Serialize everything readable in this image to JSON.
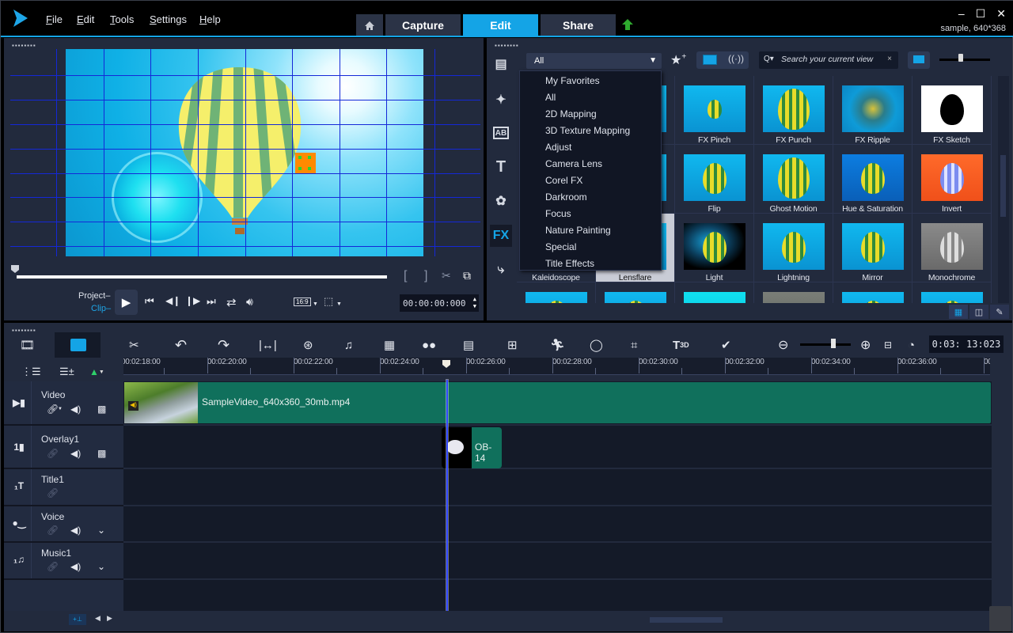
{
  "app": {
    "project_info": "sample, 640*368",
    "menu": [
      "File",
      "Edit",
      "Tools",
      "Settings",
      "Help"
    ],
    "tabs": [
      {
        "label": "Capture",
        "active": false
      },
      {
        "label": "Edit",
        "active": true
      },
      {
        "label": "Share",
        "active": false
      }
    ],
    "home_icon": "home-icon",
    "upload_icon": "upload-arrow-icon",
    "window_controls": {
      "minimize": "–",
      "maximize": "☐",
      "close": "✕"
    },
    "accent_color": "#14a4e6"
  },
  "player": {
    "mode_labels": {
      "project": "Project–",
      "clip": "Clip–"
    },
    "active_mode": "Clip",
    "scrub_position": 0,
    "timecode": "00:00:00:000",
    "aspect": "16:9",
    "controls": [
      "play",
      "home",
      "prev-frame",
      "next-frame",
      "end",
      "repeat",
      "volume"
    ],
    "marks": {
      "mark_in": "[",
      "mark_out": "]"
    }
  },
  "library": {
    "filter_selected": "All",
    "search_placeholder": "Search your current view",
    "sidebar": [
      {
        "name": "media",
        "active": false
      },
      {
        "name": "instant-project",
        "active": false
      },
      {
        "name": "transition",
        "active": false
      },
      {
        "name": "title",
        "active": false,
        "glyph": "T"
      },
      {
        "name": "graphic",
        "active": false
      },
      {
        "name": "filter",
        "active": true,
        "glyph": "FX"
      },
      {
        "name": "path",
        "active": false
      }
    ],
    "dropdown_options": [
      "My Favorites",
      "All",
      "2D Mapping",
      "3D Texture Mapping",
      "Adjust",
      "Camera Lens",
      "Corel FX",
      "Darkroom",
      "Focus",
      "Nature Painting",
      "Special",
      "Title Effects"
    ],
    "filters": [
      {
        "label": "",
        "row": 0,
        "col": 1,
        "style": "blue"
      },
      {
        "label": "FX Pinch",
        "row": 0,
        "col": 2,
        "style": "blue-small"
      },
      {
        "label": "FX Punch",
        "row": 0,
        "col": 3,
        "style": "blue-big"
      },
      {
        "label": "FX Ripple",
        "row": 0,
        "col": 4,
        "style": "ripple"
      },
      {
        "label": "FX Sketch",
        "row": 0,
        "col": 5,
        "style": "sketch"
      },
      {
        "label": "",
        "row": 1,
        "col": 1,
        "style": "blue"
      },
      {
        "label": "Flip",
        "row": 1,
        "col": 2,
        "style": "blue"
      },
      {
        "label": "Ghost Motion",
        "row": 1,
        "col": 3,
        "style": "blue-big"
      },
      {
        "label": "Hue & Saturation",
        "row": 1,
        "col": 4,
        "style": "deep-blue"
      },
      {
        "label": "Invert",
        "row": 1,
        "col": 5,
        "style": "invert"
      },
      {
        "label": "Kaleidoscope",
        "row": 2,
        "col": 0,
        "style": "blue"
      },
      {
        "label": "Lensflare",
        "row": 2,
        "col": 1,
        "style": "blue",
        "selected": true
      },
      {
        "label": "Light",
        "row": 2,
        "col": 2,
        "style": "light"
      },
      {
        "label": "Lightning",
        "row": 2,
        "col": 3,
        "style": "lightning"
      },
      {
        "label": "Mirror",
        "row": 2,
        "col": 4,
        "style": "mirror"
      },
      {
        "label": "Monochrome",
        "row": 2,
        "col": 5,
        "style": "mono"
      },
      {
        "label": "",
        "row": 3,
        "col": 0,
        "style": "blue"
      },
      {
        "label": "",
        "row": 3,
        "col": 1,
        "style": "blue"
      },
      {
        "label": "",
        "row": 3,
        "col": 2,
        "style": "cyan"
      },
      {
        "label": "",
        "row": 3,
        "col": 3,
        "style": "grey"
      },
      {
        "label": "",
        "row": 3,
        "col": 4,
        "style": "blue"
      },
      {
        "label": "",
        "row": 3,
        "col": 5,
        "style": "blue"
      }
    ]
  },
  "timeline": {
    "timecode": "0:03: 13:023",
    "zoom_level": 0.62,
    "ruler": [
      "00:02:18:00",
      "00:02:20:00",
      "00:02:22:00",
      "00:02:24:00",
      "00:02:26:00",
      "00:02:28:00",
      "00:02:30:00",
      "00:02:32:00",
      "00:02:34:00",
      "00:02:36:00",
      "00:0"
    ],
    "tracks": [
      {
        "name": "Video",
        "icon": "video-track-icon",
        "controls": [
          "link",
          "volume",
          "transparency"
        ],
        "link_dim": false
      },
      {
        "name": "Overlay1",
        "icon": "overlay-track-icon",
        "controls": [
          "link",
          "volume",
          "transparency"
        ],
        "link_dim": true
      },
      {
        "name": "Title1",
        "icon": "title-track-icon",
        "controls": [
          "link"
        ],
        "link_dim": true
      },
      {
        "name": "Voice",
        "icon": "voice-track-icon",
        "controls": [
          "link",
          "volume",
          "expand"
        ],
        "link_dim": true
      },
      {
        "name": "Music1",
        "icon": "music-track-icon",
        "controls": [
          "link",
          "volume",
          "expand"
        ],
        "link_dim": true
      }
    ],
    "clips": {
      "video": "SampleVideo_640x360_30mb.mp4",
      "overlay": "OB-14"
    }
  }
}
